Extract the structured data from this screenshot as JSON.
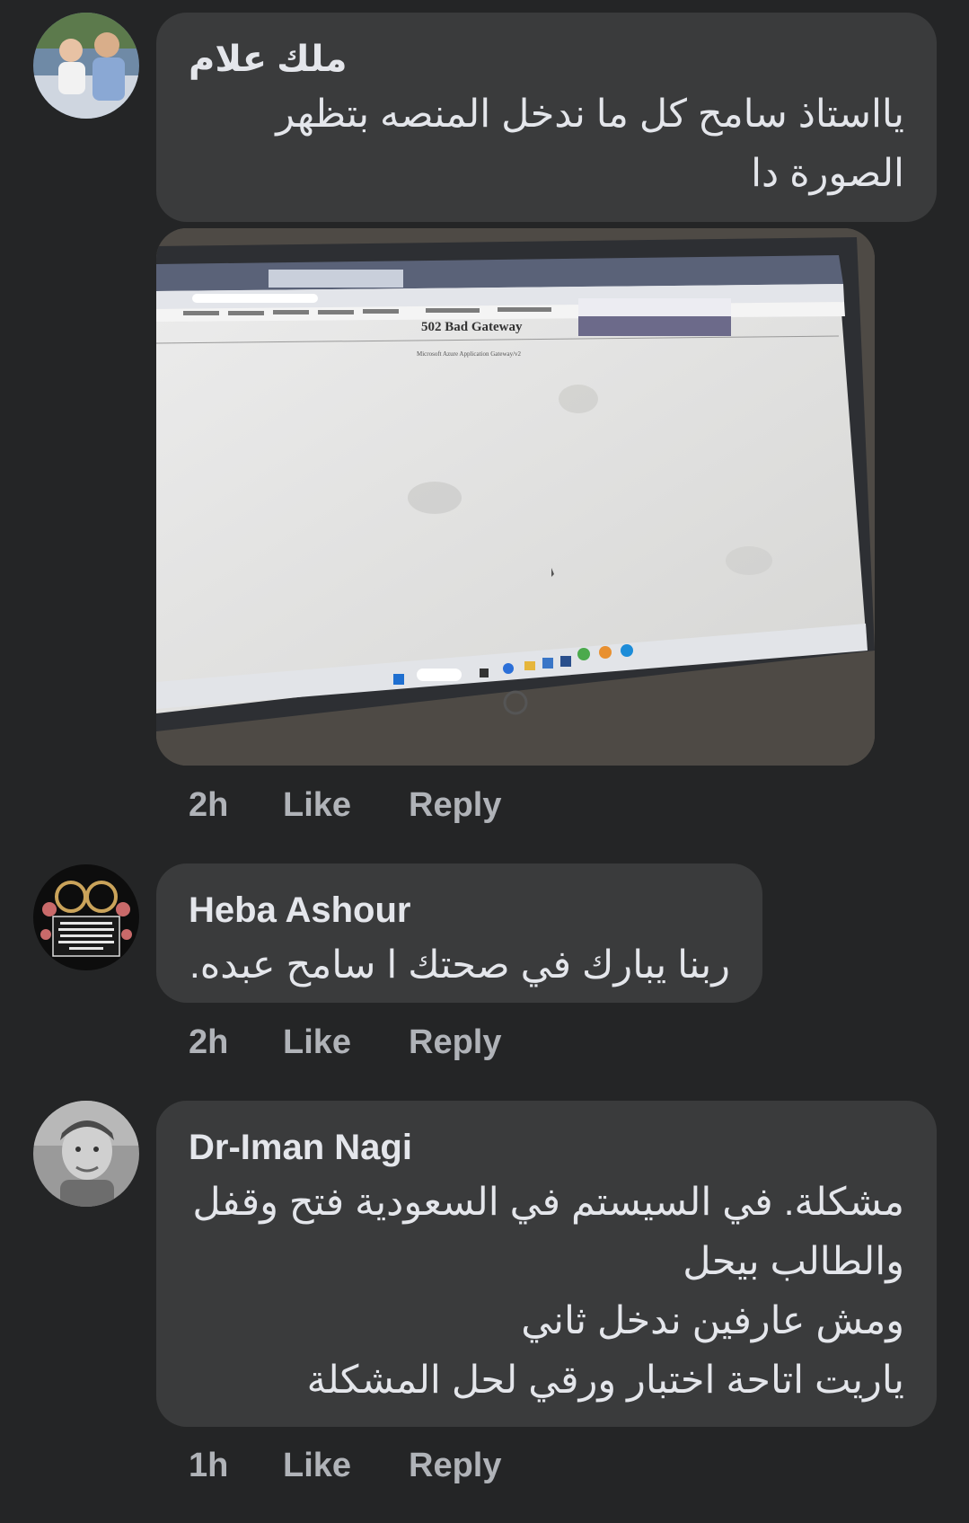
{
  "comments": [
    {
      "author": "ملك علام",
      "lines": [
        "يااستاذ سامح  كل ما ندخل المنصه بتظهر",
        "الصورة دا"
      ],
      "time": "2h",
      "like_label": "Like",
      "reply_label": "Reply",
      "attachment": {
        "error_title": "502 Bad Gateway",
        "error_subtitle": "Microsoft Azure Application Gateway/v2"
      }
    },
    {
      "author": "Heba Ashour",
      "lines": [
        "ربنا يبارك في صحتك ا سامح عبده."
      ],
      "time": "2h",
      "like_label": "Like",
      "reply_label": "Reply"
    },
    {
      "author": "Dr-Iman Nagi",
      "lines": [
        "مشكلة. في السيستم في السعودية  فتح وقفل",
        "والطالب بيحل",
        "ومش عارفين ندخل ثاني",
        "ياريت اتاحة اختبار ورقي لحل المشكلة"
      ],
      "time": "1h",
      "like_label": "Like",
      "reply_label": "Reply"
    }
  ],
  "colors": {
    "background": "#242526",
    "bubble": "#3a3b3c",
    "text": "#e4e6eb",
    "secondary_text": "#b0b3b8"
  }
}
